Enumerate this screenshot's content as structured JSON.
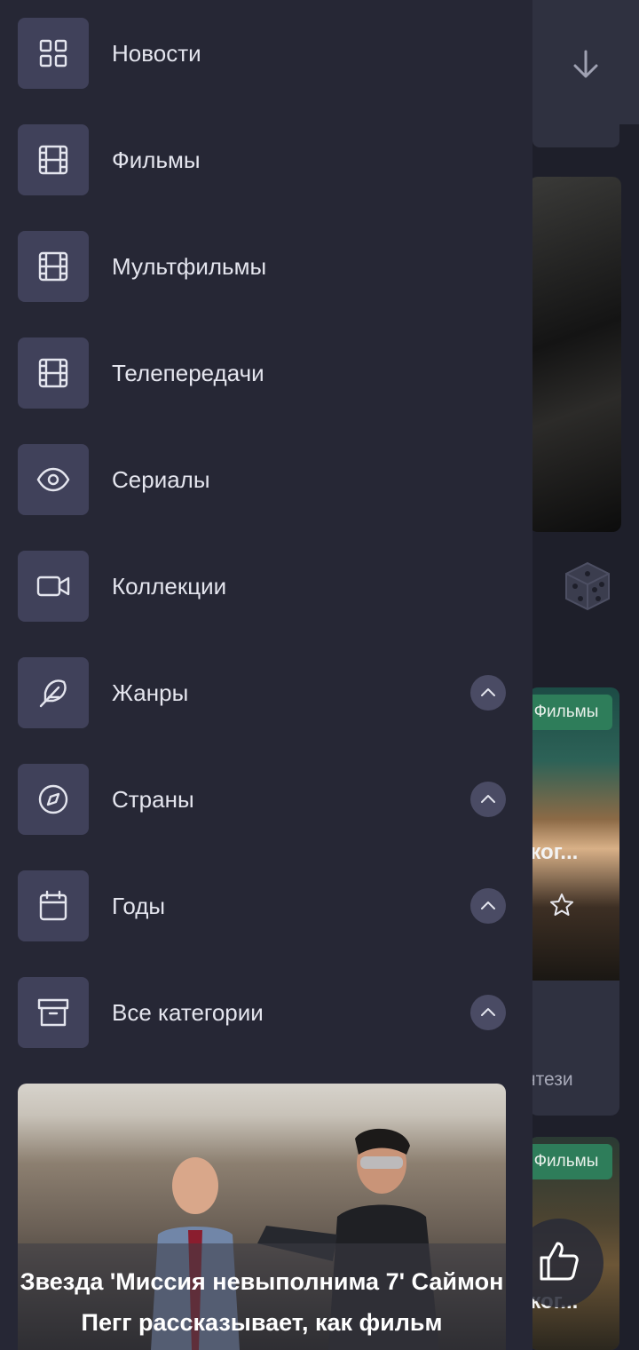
{
  "menu": [
    {
      "label": "Новости",
      "icon": "grid-icon",
      "expandable": false
    },
    {
      "label": "Фильмы",
      "icon": "film-icon",
      "expandable": false
    },
    {
      "label": "Мультфильмы",
      "icon": "film-icon",
      "expandable": false
    },
    {
      "label": "Телепередачи",
      "icon": "film-icon",
      "expandable": false
    },
    {
      "label": "Сериалы",
      "icon": "eye-icon",
      "expandable": false
    },
    {
      "label": "Коллекции",
      "icon": "video-camera-icon",
      "expandable": false
    },
    {
      "label": "Жанры",
      "icon": "feather-icon",
      "expandable": true
    },
    {
      "label": "Страны",
      "icon": "compass-icon",
      "expandable": true
    },
    {
      "label": "Годы",
      "icon": "calendar-icon",
      "expandable": true
    },
    {
      "label": "Все категории",
      "icon": "archive-icon",
      "expandable": true
    }
  ],
  "news_card": {
    "title_line1": "Звезда 'Миссия невыполнима 7' Саймон",
    "title_line2": "Пегг рассказывает, как фильм"
  },
  "background": {
    "card1": {
      "badge": "Фильмы",
      "title": "ског...",
      "genre": "нтези"
    },
    "card2": {
      "badge": "Фильмы",
      "title": "ског..."
    }
  },
  "colors": {
    "drawer_bg": "#262735",
    "icon_box": "#40415a",
    "badge_green": "#2e7d5a"
  }
}
